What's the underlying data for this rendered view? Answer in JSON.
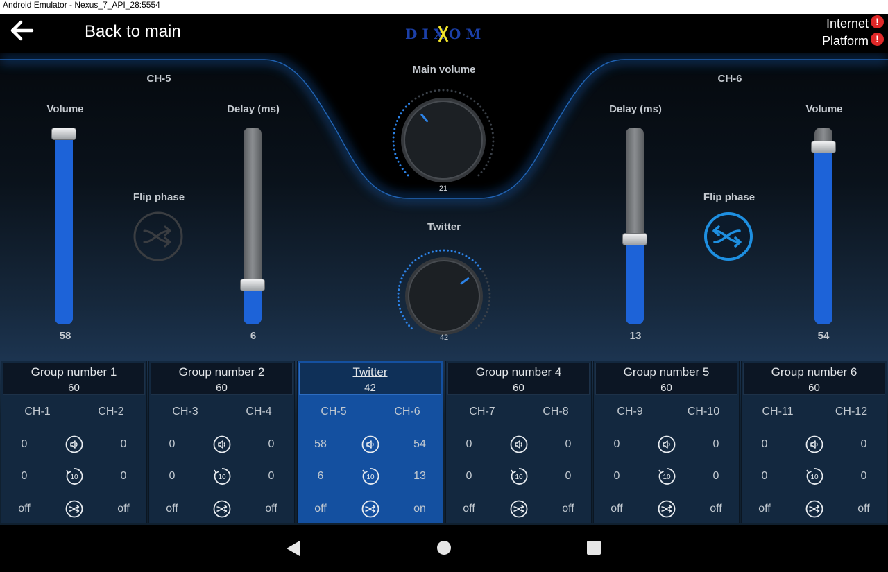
{
  "window": {
    "title": "Android Emulator - Nexus_7_API_28:5554"
  },
  "topbar": {
    "back_label": "Back to main",
    "logo_text": "DIXOM",
    "status": [
      {
        "label": "Internet",
        "badge": "!"
      },
      {
        "label": "Platform",
        "badge": "!"
      }
    ]
  },
  "left_channel": {
    "title": "CH-5",
    "volume_label": "Volume",
    "volume": 58,
    "delay_label": "Delay (ms)",
    "delay": 6,
    "phase_label": "Flip phase",
    "phase_on": false
  },
  "right_channel": {
    "title": "CH-6",
    "volume_label": "Volume",
    "volume": 54,
    "delay_label": "Delay (ms)",
    "delay": 13,
    "phase_label": "Flip phase",
    "phase_on": true
  },
  "main_volume": {
    "label": "Main volume",
    "value": "21"
  },
  "twitter": {
    "label": "Twitter",
    "value": "42"
  },
  "groups": [
    {
      "name": "Group number 1",
      "value": "60",
      "ch_a": "CH-1",
      "ch_b": "CH-2",
      "vol_a": "0",
      "vol_b": "0",
      "delay_a": "0",
      "delay_b": "0",
      "phase_a": "off",
      "phase_b": "off"
    },
    {
      "name": "Group number 2",
      "value": "60",
      "ch_a": "CH-3",
      "ch_b": "CH-4",
      "vol_a": "0",
      "vol_b": "0",
      "delay_a": "0",
      "delay_b": "0",
      "phase_a": "off",
      "phase_b": "off"
    },
    {
      "name": "Twitter",
      "value": "42",
      "ch_a": "CH-5",
      "ch_b": "CH-6",
      "vol_a": "58",
      "vol_b": "54",
      "delay_a": "6",
      "delay_b": "13",
      "phase_a": "off",
      "phase_b": "on"
    },
    {
      "name": "Group number 4",
      "value": "60",
      "ch_a": "CH-7",
      "ch_b": "CH-8",
      "vol_a": "0",
      "vol_b": "0",
      "delay_a": "0",
      "delay_b": "0",
      "phase_a": "off",
      "phase_b": "off"
    },
    {
      "name": "Group number 5",
      "value": "60",
      "ch_a": "CH-9",
      "ch_b": "CH-10",
      "vol_a": "0",
      "vol_b": "0",
      "delay_a": "0",
      "delay_b": "0",
      "phase_a": "off",
      "phase_b": "off"
    },
    {
      "name": "Group number 6",
      "value": "60",
      "ch_a": "CH-11",
      "ch_b": "CH-12",
      "vol_a": "0",
      "vol_b": "0",
      "delay_a": "0",
      "delay_b": "0",
      "phase_a": "off",
      "phase_b": "off"
    }
  ],
  "active_group": 2,
  "icons": {
    "volume": "speaker-icon",
    "delay": "delay-10-icon",
    "phase": "shuffle-icon"
  },
  "colors": {
    "accent": "#1d63d8",
    "active_group_bg": "#1450a0",
    "phase_on": "#1e8fe0",
    "warning": "#e02828"
  }
}
